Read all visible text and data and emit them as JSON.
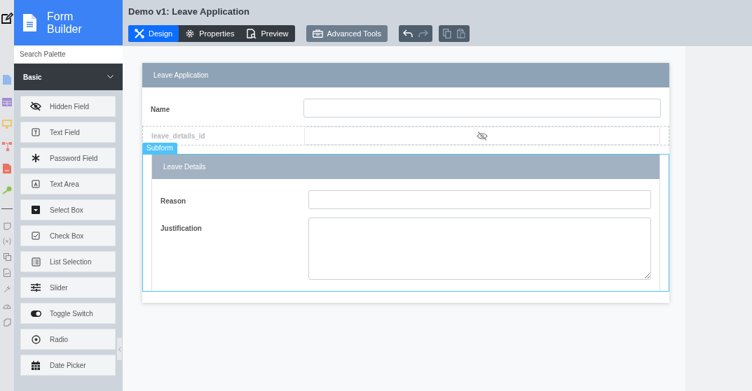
{
  "palette": {
    "title": "Form Builder",
    "search": {
      "placeholder": "Search Palette"
    },
    "category": {
      "label": "Basic",
      "expanded": true
    },
    "items": [
      {
        "kind": "hidden",
        "label": "Hidden Field"
      },
      {
        "kind": "text",
        "label": "Text Field"
      },
      {
        "kind": "password",
        "label": "Password Field"
      },
      {
        "kind": "textarea",
        "label": "Text Area"
      },
      {
        "kind": "select",
        "label": "Select Box"
      },
      {
        "kind": "checkbox",
        "label": "Check Box"
      },
      {
        "kind": "list",
        "label": "List Selection"
      },
      {
        "kind": "slider",
        "label": "Slider"
      },
      {
        "kind": "toggle",
        "label": "Toggle Switch"
      },
      {
        "kind": "radio",
        "label": "Radio"
      },
      {
        "kind": "date",
        "label": "Date Picker"
      }
    ]
  },
  "header": {
    "title": "Demo v1: Leave Application",
    "tabs": [
      {
        "kind": "design",
        "label": "Design",
        "selected": true
      },
      {
        "kind": "properties",
        "label": "Properties",
        "selected": false
      },
      {
        "kind": "preview",
        "label": "Preview",
        "selected": false
      }
    ],
    "advanced_tools": "Advanced Tools"
  },
  "form": {
    "title": "Leave Application",
    "fields": [
      {
        "kind": "text",
        "label": "Name"
      },
      {
        "kind": "hidden",
        "label": "leave_details_id"
      }
    ],
    "subform": {
      "badge": "Subform",
      "title": "Leave Details",
      "fields": [
        {
          "kind": "text",
          "label": "Reason"
        },
        {
          "kind": "textarea",
          "label": "Justification"
        }
      ]
    }
  }
}
